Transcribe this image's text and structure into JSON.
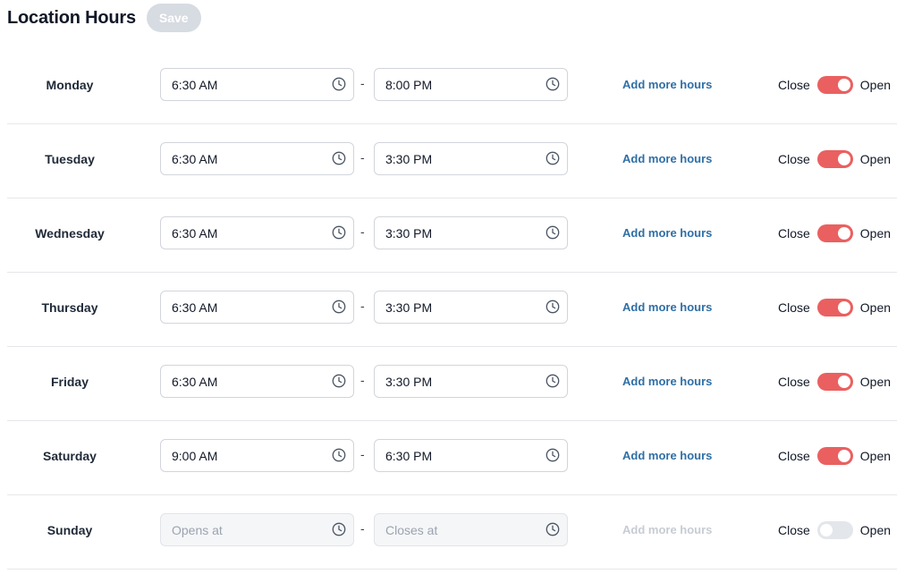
{
  "header": {
    "title": "Location Hours",
    "save_label": "Save"
  },
  "colors": {
    "toggle_on": "#ea6060",
    "toggle_off": "#e3e6ea",
    "link": "#2f6fa6",
    "save_disabled": "#d7dbe2"
  },
  "labels": {
    "close": "Close",
    "open": "Open",
    "dash": "-",
    "add_more": "Add more hours"
  },
  "days": [
    {
      "day": "Monday",
      "open_value": "6:30 AM",
      "close_value": "8:00 PM",
      "is_open": true
    },
    {
      "day": "Tuesday",
      "open_value": "6:30 AM",
      "close_value": "3:30 PM",
      "is_open": true
    },
    {
      "day": "Wednesday",
      "open_value": "6:30 AM",
      "close_value": "3:30 PM",
      "is_open": true
    },
    {
      "day": "Thursday",
      "open_value": "6:30 AM",
      "close_value": "3:30 PM",
      "is_open": true
    },
    {
      "day": "Friday",
      "open_value": "6:30 AM",
      "close_value": "3:30 PM",
      "is_open": true
    },
    {
      "day": "Saturday",
      "open_value": "9:00 AM",
      "close_value": "6:30 PM",
      "is_open": true
    },
    {
      "day": "Sunday",
      "open_value": "",
      "close_value": "",
      "open_placeholder": "Opens at",
      "close_placeholder": "Closes at",
      "is_open": false
    }
  ]
}
